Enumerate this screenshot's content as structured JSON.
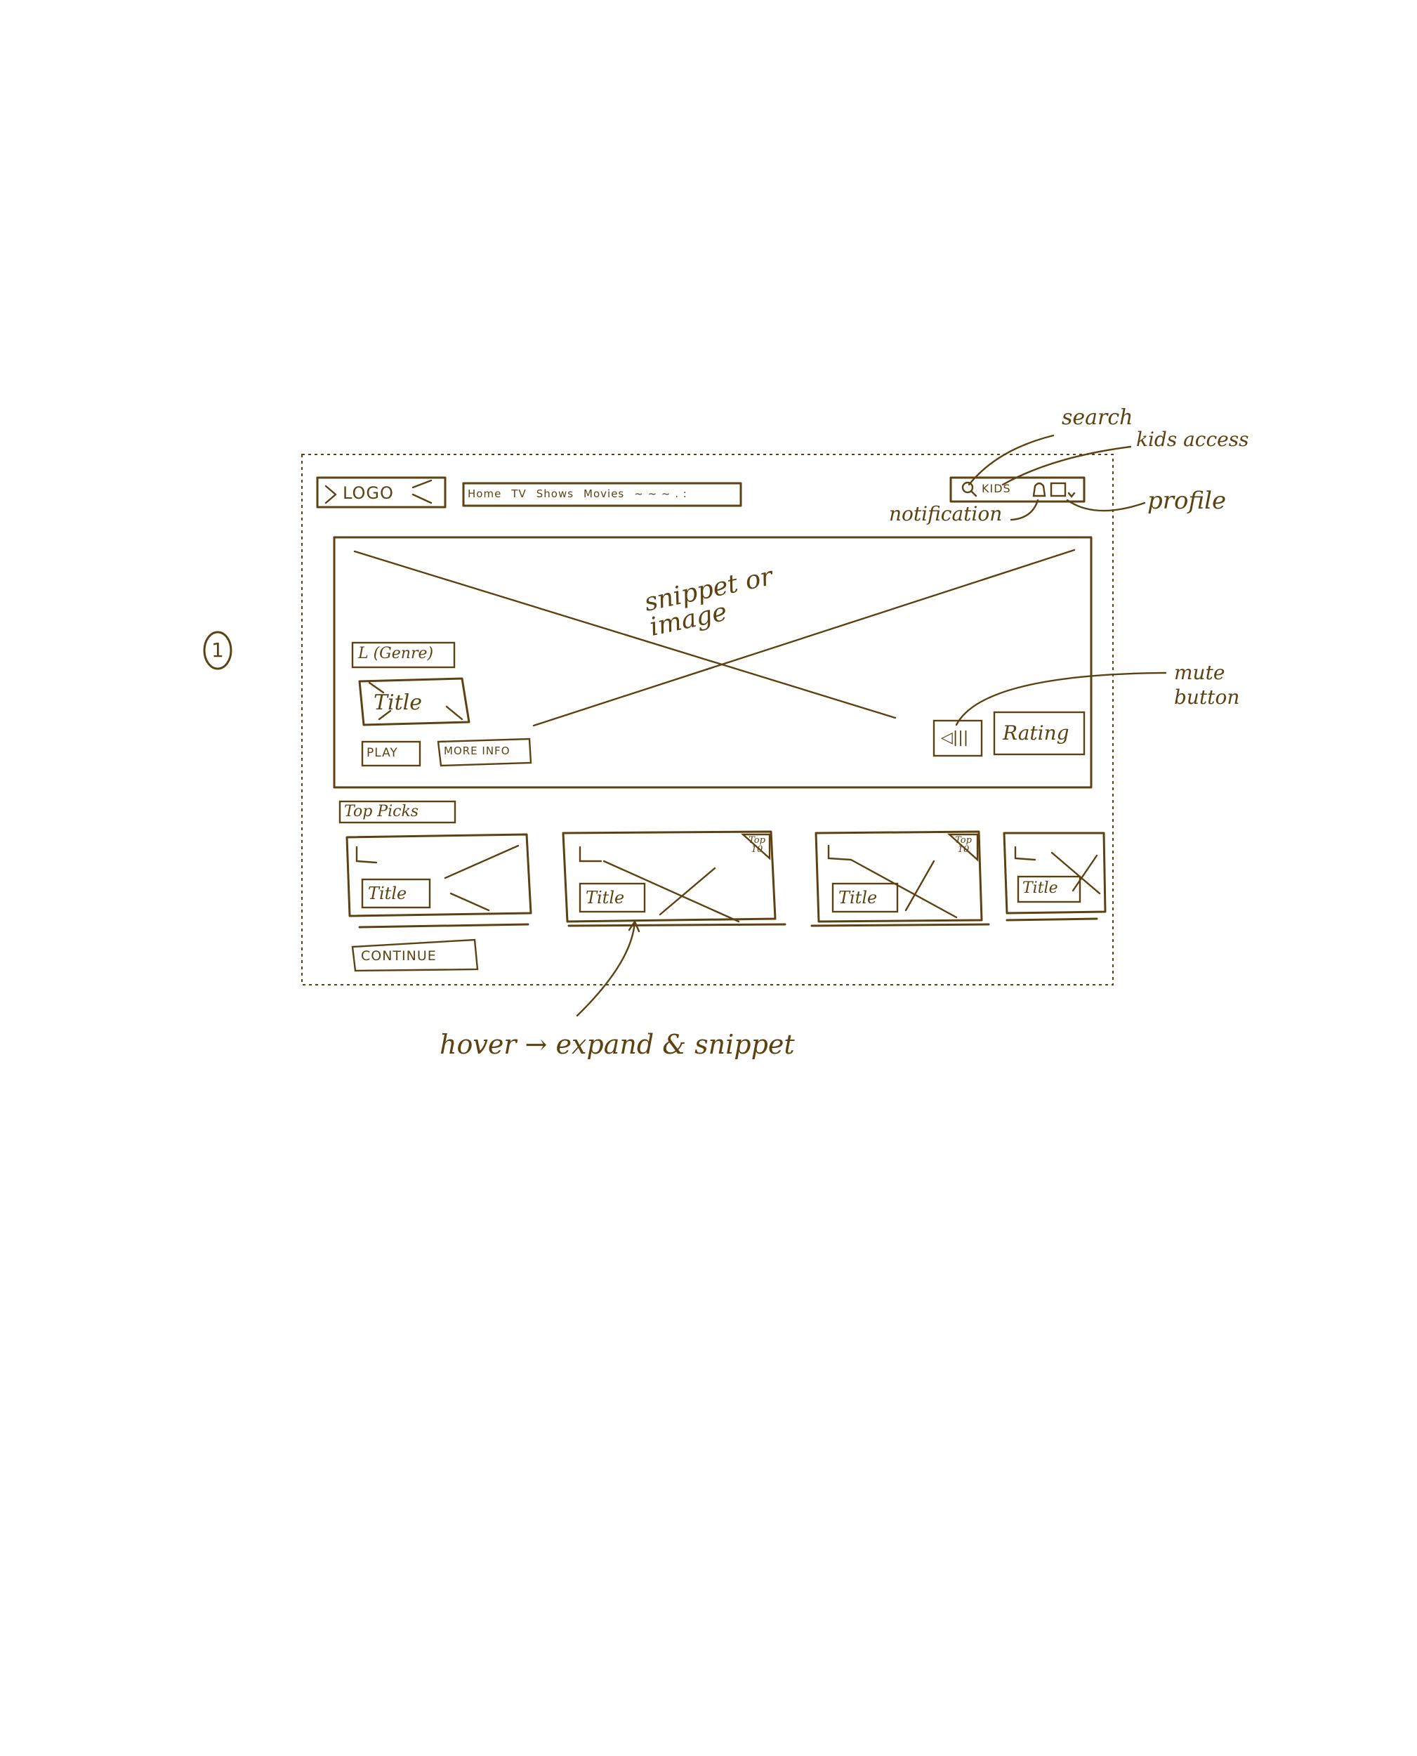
{
  "ink_color": "#5c4210",
  "page_number": "1",
  "header": {
    "logo": "LOGO",
    "nav_items": [
      "Home",
      "TV",
      "Shows",
      "Movies"
    ],
    "nav_more": "~ ~ ~ . :",
    "kids": "KIDS"
  },
  "hero": {
    "placeholder": "snippet or image",
    "genre": "L (Genre)",
    "title": "Title",
    "play": "PLAY",
    "more_info": "MORE INFO",
    "rating": "Rating"
  },
  "top_picks": {
    "heading": "Top Picks",
    "cards": [
      {
        "title": "Title",
        "badge": ""
      },
      {
        "title": "Title",
        "badge": "Top 10"
      },
      {
        "title": "Title",
        "badge": "Top 10"
      },
      {
        "title": "Title",
        "badge": ""
      }
    ],
    "continue": "CONTINUE"
  },
  "annotations": {
    "search": "search",
    "kids_access": "kids access",
    "notification": "notification",
    "profile": "profile",
    "mute_button": "mute button",
    "hover_note": "hover → expand & snippet"
  }
}
